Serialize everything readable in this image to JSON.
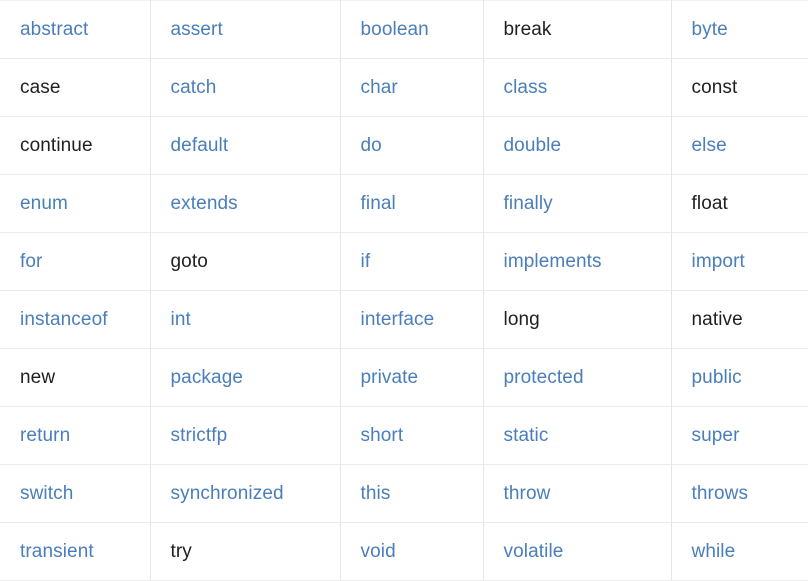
{
  "table": {
    "name": "java-keywords-table",
    "columns": 5,
    "rows": 10,
    "colors": {
      "link": "#4a7ebb",
      "plain": "#1f1f1f",
      "grid": "#e6e6e6",
      "background": "#ffffff"
    },
    "cells": [
      [
        {
          "text": "abstract",
          "style": "link"
        },
        {
          "text": "assert",
          "style": "link"
        },
        {
          "text": "boolean",
          "style": "link"
        },
        {
          "text": "break",
          "style": "plain"
        },
        {
          "text": "byte",
          "style": "link"
        }
      ],
      [
        {
          "text": "case",
          "style": "plain"
        },
        {
          "text": "catch",
          "style": "link"
        },
        {
          "text": "char",
          "style": "link"
        },
        {
          "text": "class",
          "style": "link"
        },
        {
          "text": "const",
          "style": "plain"
        }
      ],
      [
        {
          "text": "continue",
          "style": "plain"
        },
        {
          "text": "default",
          "style": "link"
        },
        {
          "text": "do",
          "style": "link"
        },
        {
          "text": "double",
          "style": "link"
        },
        {
          "text": "else",
          "style": "link"
        }
      ],
      [
        {
          "text": "enum",
          "style": "link"
        },
        {
          "text": "extends",
          "style": "link"
        },
        {
          "text": "final",
          "style": "link"
        },
        {
          "text": "finally",
          "style": "link"
        },
        {
          "text": "float",
          "style": "plain"
        }
      ],
      [
        {
          "text": "for",
          "style": "link"
        },
        {
          "text": "goto",
          "style": "plain"
        },
        {
          "text": "if",
          "style": "link"
        },
        {
          "text": "implements",
          "style": "link"
        },
        {
          "text": "import",
          "style": "link"
        }
      ],
      [
        {
          "text": "instanceof",
          "style": "link"
        },
        {
          "text": "int",
          "style": "link"
        },
        {
          "text": "interface",
          "style": "link"
        },
        {
          "text": "long",
          "style": "plain"
        },
        {
          "text": "native",
          "style": "plain"
        }
      ],
      [
        {
          "text": "new",
          "style": "plain"
        },
        {
          "text": "package",
          "style": "link"
        },
        {
          "text": "private",
          "style": "link"
        },
        {
          "text": "protected",
          "style": "link"
        },
        {
          "text": "public",
          "style": "link"
        }
      ],
      [
        {
          "text": "return",
          "style": "link"
        },
        {
          "text": "strictfp",
          "style": "link"
        },
        {
          "text": "short",
          "style": "link"
        },
        {
          "text": "static",
          "style": "link"
        },
        {
          "text": "super",
          "style": "link"
        }
      ],
      [
        {
          "text": "switch",
          "style": "link"
        },
        {
          "text": "synchronized",
          "style": "link"
        },
        {
          "text": "this",
          "style": "link"
        },
        {
          "text": "throw",
          "style": "link"
        },
        {
          "text": "throws",
          "style": "link"
        }
      ],
      [
        {
          "text": "transient",
          "style": "link"
        },
        {
          "text": "try",
          "style": "plain"
        },
        {
          "text": "void",
          "style": "link"
        },
        {
          "text": "volatile",
          "style": "link"
        },
        {
          "text": "while",
          "style": "link"
        }
      ]
    ]
  }
}
